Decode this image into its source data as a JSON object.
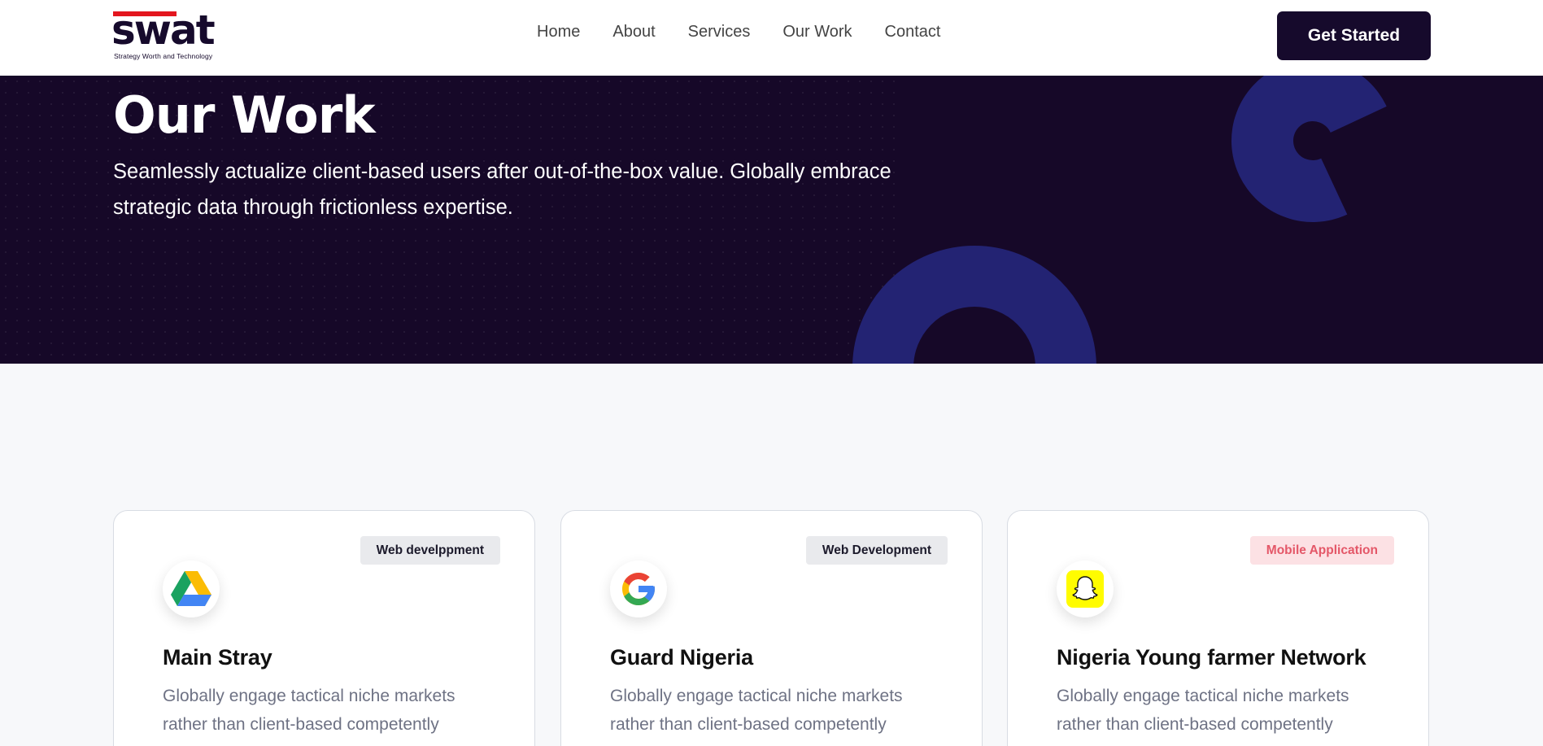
{
  "brand": {
    "name": "swat",
    "tagline": "Strategy Worth and Technology",
    "accent_color": "#e3161e",
    "primary_color": "#160a2c"
  },
  "nav": {
    "items": [
      "Home",
      "About",
      "Services",
      "Our Work",
      "Contact"
    ],
    "cta_label": "Get Started"
  },
  "hero": {
    "title": "Our Work",
    "subtitle": "Seamlessly actualize client-based users after out-of-the-box value. Globally embrace strategic data through frictionless expertise.",
    "background_color": "#160828",
    "shape_color": "#232373"
  },
  "cards": [
    {
      "badge": "Web develppment",
      "badge_style": "grey",
      "icon": "google-drive-icon",
      "title": "Main Stray",
      "description": "Globally engage tactical niche markets rather than client-based competently"
    },
    {
      "badge": "Web Development",
      "badge_style": "grey",
      "icon": "google-icon",
      "title": "Guard Nigeria",
      "description": "Globally engage tactical niche markets rather than client-based competently"
    },
    {
      "badge": "Mobile Application",
      "badge_style": "pink",
      "icon": "snapchat-icon",
      "title": "Nigeria Young farmer Network",
      "description": "Globally engage tactical niche markets rather than client-based competently"
    }
  ]
}
